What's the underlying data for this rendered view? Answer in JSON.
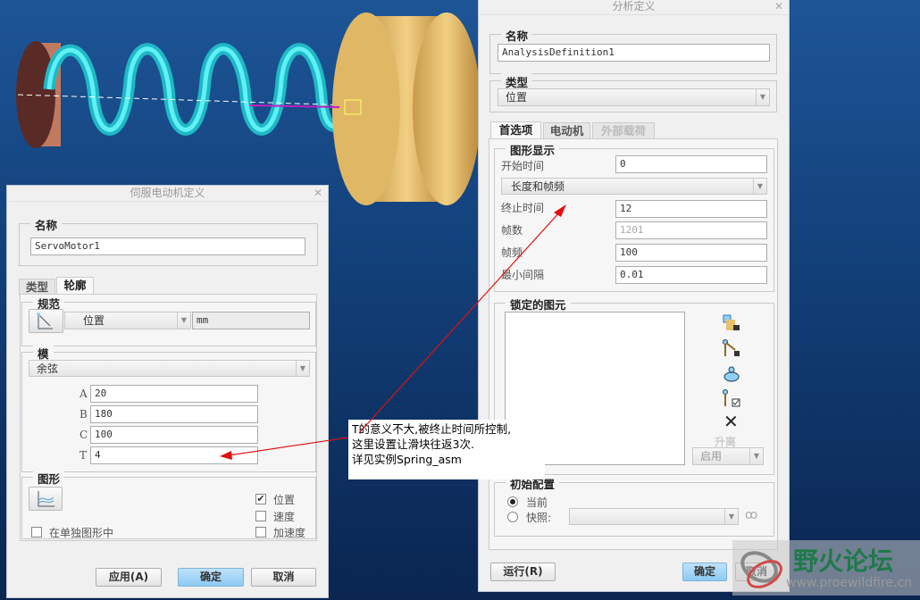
{
  "analysis_dialog": {
    "title": "分析定义",
    "name_group": "名称",
    "name_value": "AnalysisDefinition1",
    "type_group": "类型",
    "type_value": "位置",
    "tabs": [
      "首选项",
      "电动机",
      "外部载荷"
    ],
    "graphics_group": "图形显示",
    "start_time_label": "开始时间",
    "start_time_value": "0",
    "mode_select": "长度和帧频",
    "end_time_label": "终止时间",
    "end_time_value": "12",
    "frames_label": "帧数",
    "frames_value": "1201",
    "frame_rate_label": "帧频",
    "frame_rate_value": "100",
    "min_interval_label": "最小间隔",
    "min_interval_value": "0.01",
    "locked_group": "锁定的图元",
    "lift_label": "升离",
    "enable_select": "启用",
    "initial_group": "初始配置",
    "radio_current": "当前",
    "radio_snapshot": "快照:",
    "run_button": "运行(R)",
    "ok_button": "确定",
    "cancel_button": "取消"
  },
  "servo_dialog": {
    "title": "伺服电动机定义",
    "name_group": "名称",
    "name_value": "ServoMotor1",
    "tabs": [
      "类型",
      "轮廓"
    ],
    "spec_group": "规范",
    "spec_value": "位置",
    "unit_value": "mm",
    "model_group": "模",
    "model_value": "余弦",
    "params": [
      {
        "label": "A",
        "value": "20"
      },
      {
        "label": "B",
        "value": "180"
      },
      {
        "label": "C",
        "value": "100"
      },
      {
        "label": "T",
        "value": "4"
      }
    ],
    "graph_group": "图形",
    "separate_graph": "在单独图形中",
    "checks": [
      {
        "label": "位置",
        "checked": true
      },
      {
        "label": "速度",
        "checked": false
      },
      {
        "label": "加速度",
        "checked": false
      }
    ],
    "apply_button": "应用(A)",
    "ok_button": "确定",
    "cancel_button": "取消"
  },
  "annotation": {
    "line1": "T的意义不大,被终止时间所控制,",
    "line2": "这里设置让滑块往返3次.",
    "line3": "详见实例Spring_asm"
  },
  "watermark": {
    "name": "野火论坛",
    "url": "www.proewildfire.cn"
  },
  "colors": {
    "accent_button": "#8dcaf2",
    "arrow": "#e01010",
    "spring": "#22d4e0"
  }
}
